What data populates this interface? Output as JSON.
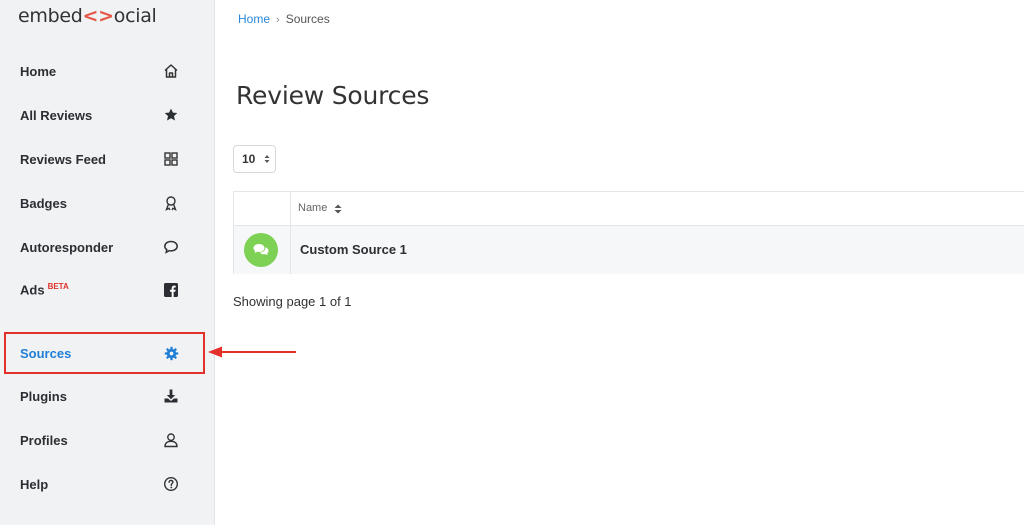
{
  "sidebar": {
    "logo": {
      "left": "embed",
      "mark": "<>",
      "right": "ocial"
    },
    "items": [
      {
        "label": "Home",
        "icon": "home-icon"
      },
      {
        "label": "All Reviews",
        "icon": "star-icon"
      },
      {
        "label": "Reviews Feed",
        "icon": "grid-icon"
      },
      {
        "label": "Badges",
        "icon": "badge-icon"
      },
      {
        "label": "Autoresponder",
        "icon": "chat-icon"
      },
      {
        "label": "Ads",
        "badge": "BETA",
        "icon": "facebook-icon"
      },
      {
        "label": "Sources",
        "icon": "gear-icon",
        "active": true
      },
      {
        "label": "Plugins",
        "icon": "download-icon"
      },
      {
        "label": "Profiles",
        "icon": "user-icon"
      },
      {
        "label": "Help",
        "icon": "help-icon"
      }
    ]
  },
  "breadcrumb": {
    "home": "Home",
    "separator": "›",
    "current": "Sources"
  },
  "main": {
    "title": "Review Sources",
    "per_page": "10",
    "table": {
      "column_name": "Name",
      "rows": [
        {
          "name": "Custom Source 1",
          "icon": "chat-bubbles-icon"
        }
      ]
    },
    "pager_info": "Showing page 1 of 1"
  },
  "colors": {
    "accent": "#1f7fd6",
    "highlight": "#e4302b",
    "source_icon": "#7dd155",
    "sidebar_bg": "#f1f2f4"
  }
}
